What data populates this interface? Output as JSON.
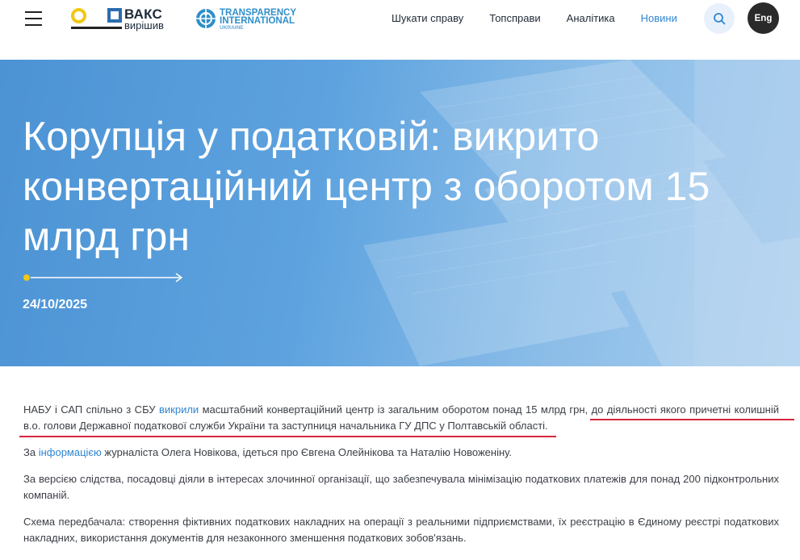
{
  "header": {
    "menu_icon": "hamburger-menu-icon",
    "logo_vaks": {
      "title": "ВАКС",
      "subtitle": "вирішив"
    },
    "logo_ti": {
      "line1": "TRANSPARENCY",
      "line2": "INTERNATIONAL",
      "line3": "UKRAINE"
    },
    "nav": [
      {
        "label": "Шукати справу"
      },
      {
        "label": "Топсправи"
      },
      {
        "label": "Аналітика"
      },
      {
        "label": "Новини",
        "active": true
      }
    ],
    "search_icon": "search-icon",
    "lang_label": "Eng"
  },
  "hero": {
    "title": "Корупція у податковій: викрито конвертаційний центр з оборотом 15 млрд грн",
    "date": "24/10/2025"
  },
  "article": {
    "p1_a": "НАБУ і САП спільно з СБУ ",
    "p1_link": "викрили",
    "p1_b": " масштабний конвертаційний центр із загальним оборотом понад 15 млрд грн, ",
    "p1_c": "до діяльності якого причетні колишній в.о. голови Державної податкової служби України та заступниця начальника ГУ ДПС у Полтавській області.",
    "p2_a": "За ",
    "p2_link": "інформацією",
    "p2_b": " журналіста Олега Новікова, ідеться про Євгена Олейнікова та Наталію Новоженіну.",
    "p3": "За версією слідства, посадовці діяли в інтересах злочинної організації, що забезпечувала мінімізацію податкових платежів для понад 200 підконтрольних компаній.",
    "p4": "Схема передбачала: створення фіктивних податкових накладних на операції з реальними підприємствами, їх реєстрацію в Єдиному реєстрі податкових накладних, використання документів для незаконного зменшення податкових зобов'язань."
  },
  "colors": {
    "accent": "#2f86d1",
    "underline": "#d7263d",
    "yellow": "#f2c811"
  }
}
